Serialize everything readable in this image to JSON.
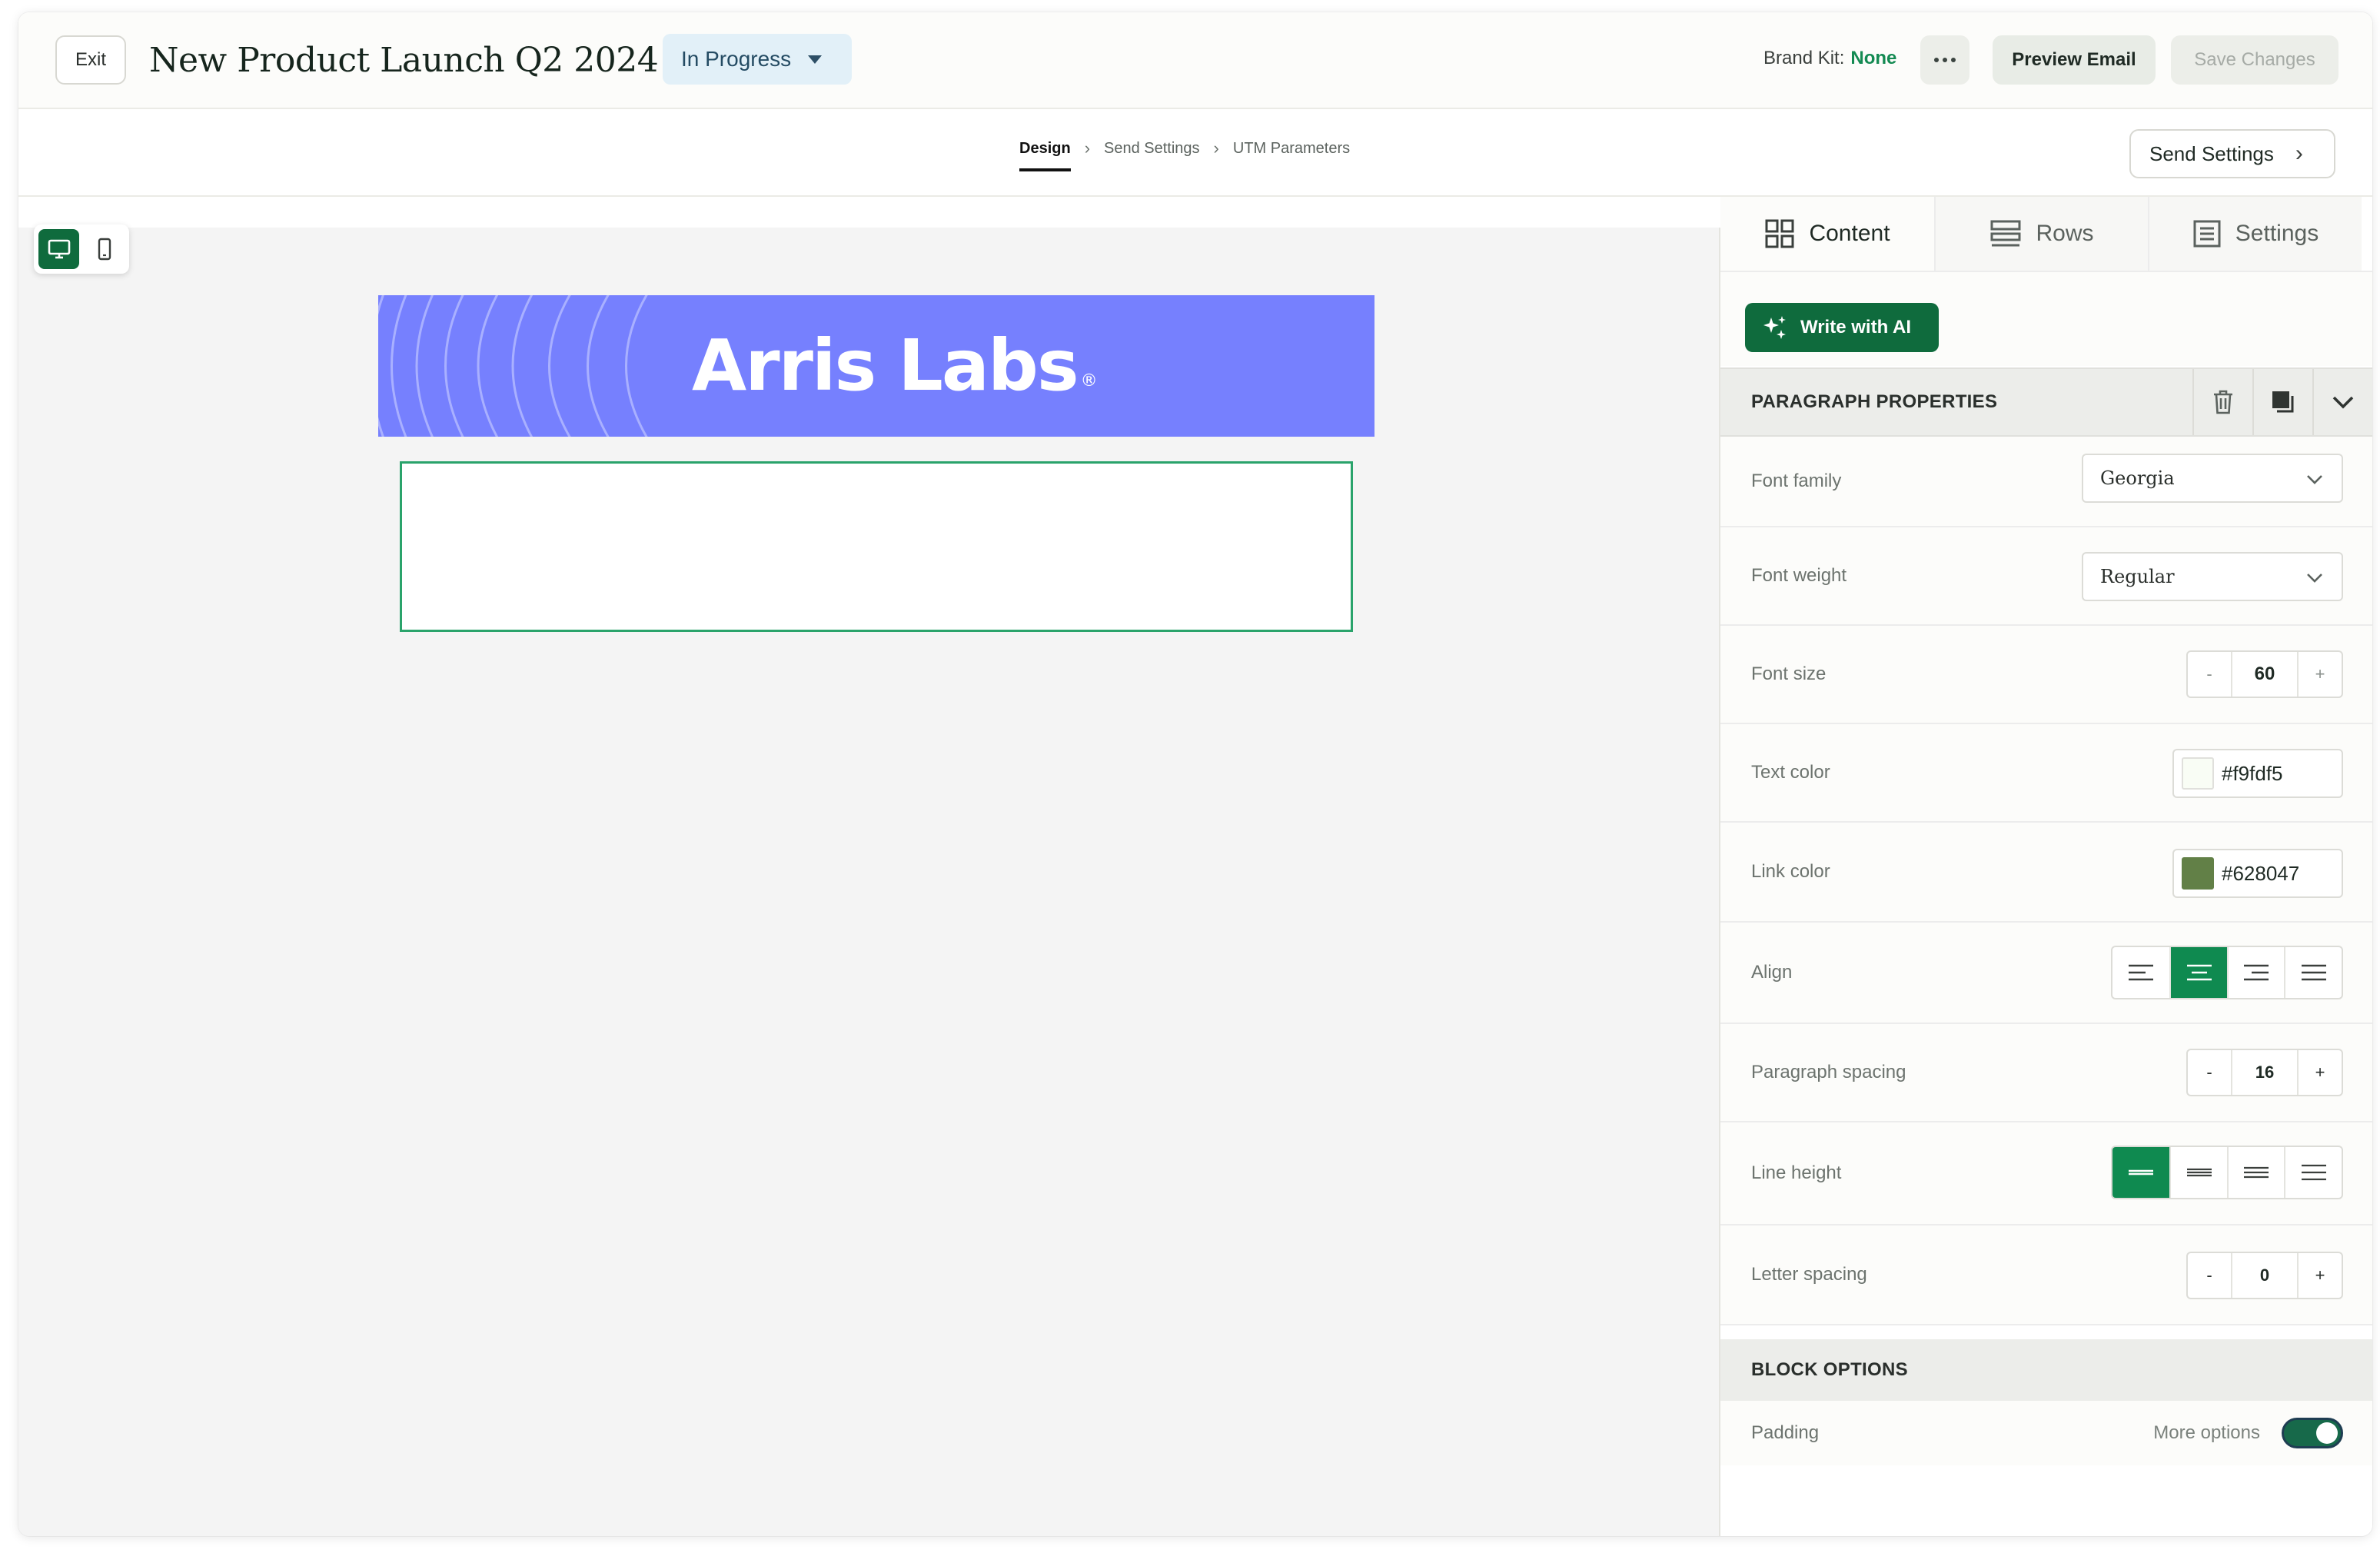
{
  "header": {
    "exit_label": "Exit",
    "title": "New Product Launch Q2 2024",
    "status": "In Progress",
    "brand_kit_label": "Brand Kit:",
    "brand_kit_value": "None",
    "preview_label": "Preview Email",
    "save_label": "Save Changes"
  },
  "breadcrumb": {
    "items": [
      "Design",
      "Send Settings",
      "UTM Parameters"
    ],
    "active": "Design",
    "next_button": "Send Settings"
  },
  "canvas": {
    "view_modes": [
      "desktop",
      "mobile"
    ],
    "active_view": "desktop",
    "banner_logo": "Arris Labs",
    "banner_logo_mark": "®",
    "banner_color": "#7680fe"
  },
  "panel": {
    "tabs": [
      {
        "label": "Content",
        "icon": "grid-icon",
        "active": true
      },
      {
        "label": "Rows",
        "icon": "rows-icon",
        "active": false
      },
      {
        "label": "Settings",
        "icon": "settings-doc-icon",
        "active": false
      }
    ],
    "ai_button": "Write with AI",
    "paragraph_section": "PARAGRAPH PROPERTIES",
    "properties": {
      "font_family": {
        "label": "Font family",
        "value": "Georgia"
      },
      "font_weight": {
        "label": "Font weight",
        "value": "Regular"
      },
      "font_size": {
        "label": "Font size",
        "value": "60",
        "minus": "-",
        "plus": "+"
      },
      "text_color": {
        "label": "Text color",
        "value": "#f9fdf5"
      },
      "link_color": {
        "label": "Link color",
        "value": "#628047"
      },
      "align": {
        "label": "Align",
        "options": [
          "left",
          "center",
          "right",
          "justify"
        ],
        "selected": "center"
      },
      "paragraph_spacing": {
        "label": "Paragraph spacing",
        "value": "16",
        "minus": "-",
        "plus": "+"
      },
      "line_height": {
        "label": "Line height",
        "options": [
          "tight",
          "normal",
          "relaxed",
          "loose"
        ],
        "selected": "tight"
      },
      "letter_spacing": {
        "label": "Letter spacing",
        "value": "0",
        "minus": "-",
        "plus": "+"
      }
    },
    "block_section": "BLOCK OPTIONS",
    "padding": {
      "label": "Padding",
      "more_options": "More options",
      "enabled": true
    }
  },
  "colors": {
    "accent_green": "#0f6b3d",
    "brand_kit_green": "#138a52",
    "selection_border": "#2aa36b"
  }
}
